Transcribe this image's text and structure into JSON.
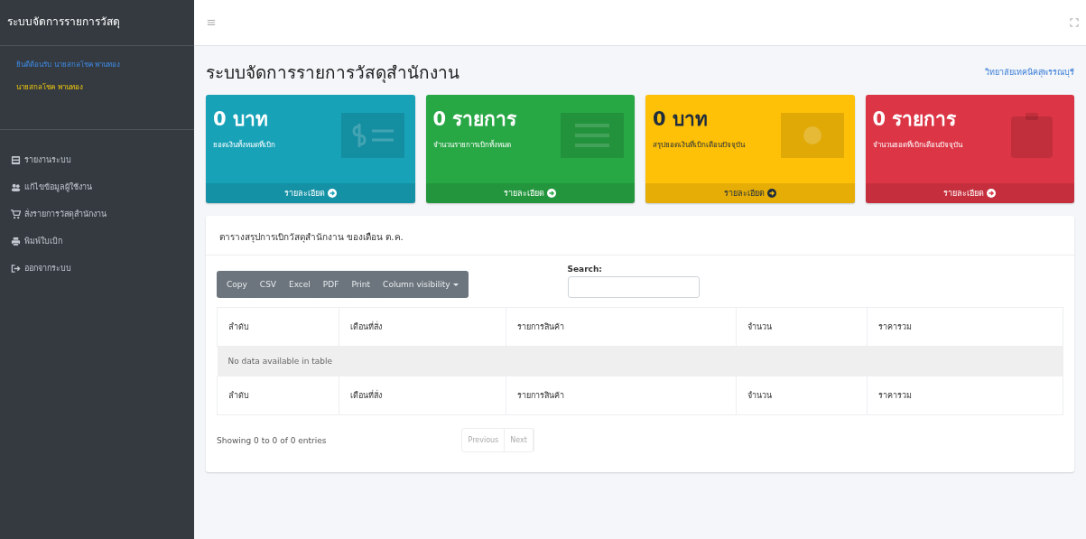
{
  "sidebar": {
    "brand": "ระบบจัดการรายการวัสดุ",
    "user_link": "ยินดีต้อนรับ นายสกลโชค พานทอง",
    "user_name": "นายสกลโชค พานทอง",
    "items": [
      {
        "label": "รายงานระบบ",
        "kind": "report"
      },
      {
        "label": "แก้ไขข้อมูลผู้ใช้งาน",
        "kind": "users"
      },
      {
        "label": "สั่งรายการวัสดุสำนักงาน",
        "kind": "cart"
      },
      {
        "label": "พิมพ์ใบเบิก",
        "kind": "print"
      },
      {
        "label": "ออกจากระบบ",
        "kind": "logout"
      }
    ]
  },
  "page": {
    "title": "ระบบจัดการรายการวัสดุสำนักงาน",
    "org_link": "วิทยาลัยเทคนิคสุพรรณบุรี"
  },
  "cards": [
    {
      "value": "0 บาท",
      "label": "ยอดเงินทั้งหมดที่เบิก",
      "footer": "รายละเอียด",
      "color": "#17a2b8",
      "kind": "money"
    },
    {
      "value": "0 รายการ",
      "label": "จำนวนรายการเบิกทั้งหมด",
      "footer": "รายละเอียด",
      "color": "#28a745",
      "kind": "list"
    },
    {
      "value": "0 บาท",
      "label": "สรุปยอดเงินที่เบิกเดือนปัจจุบัน",
      "footer": "รายละเอียด",
      "color": "#ffc107",
      "kind": "bill"
    },
    {
      "value": "0 รายการ",
      "label": "จำนวนยอดที่เบิกเดือนปัจจุบัน",
      "footer": "รายละเอียด",
      "color": "#dc3545",
      "kind": "clipboard"
    }
  ],
  "table_card": {
    "title": "ตารางสรุปการเบิกวัสดุสำนักงาน ของเดือน ต.ค.",
    "buttons": [
      "Copy",
      "CSV",
      "Excel",
      "PDF",
      "Print",
      "Column visibility"
    ],
    "search_label": "Search:",
    "columns": [
      "ลำดับ",
      "เดือนที่สั่ง",
      "รายการสินค้า",
      "จำนวน",
      "ราคารวม"
    ],
    "footer_columns": [
      "ลำดับ",
      "เดือนที่สั่ง",
      "รายการสินค้า",
      "จำนวน",
      "ราคารวม"
    ],
    "empty_message": "No data available in table",
    "info": "Showing 0 to 0 of 0 entries",
    "pagination": [
      "Previous",
      "Next"
    ]
  }
}
